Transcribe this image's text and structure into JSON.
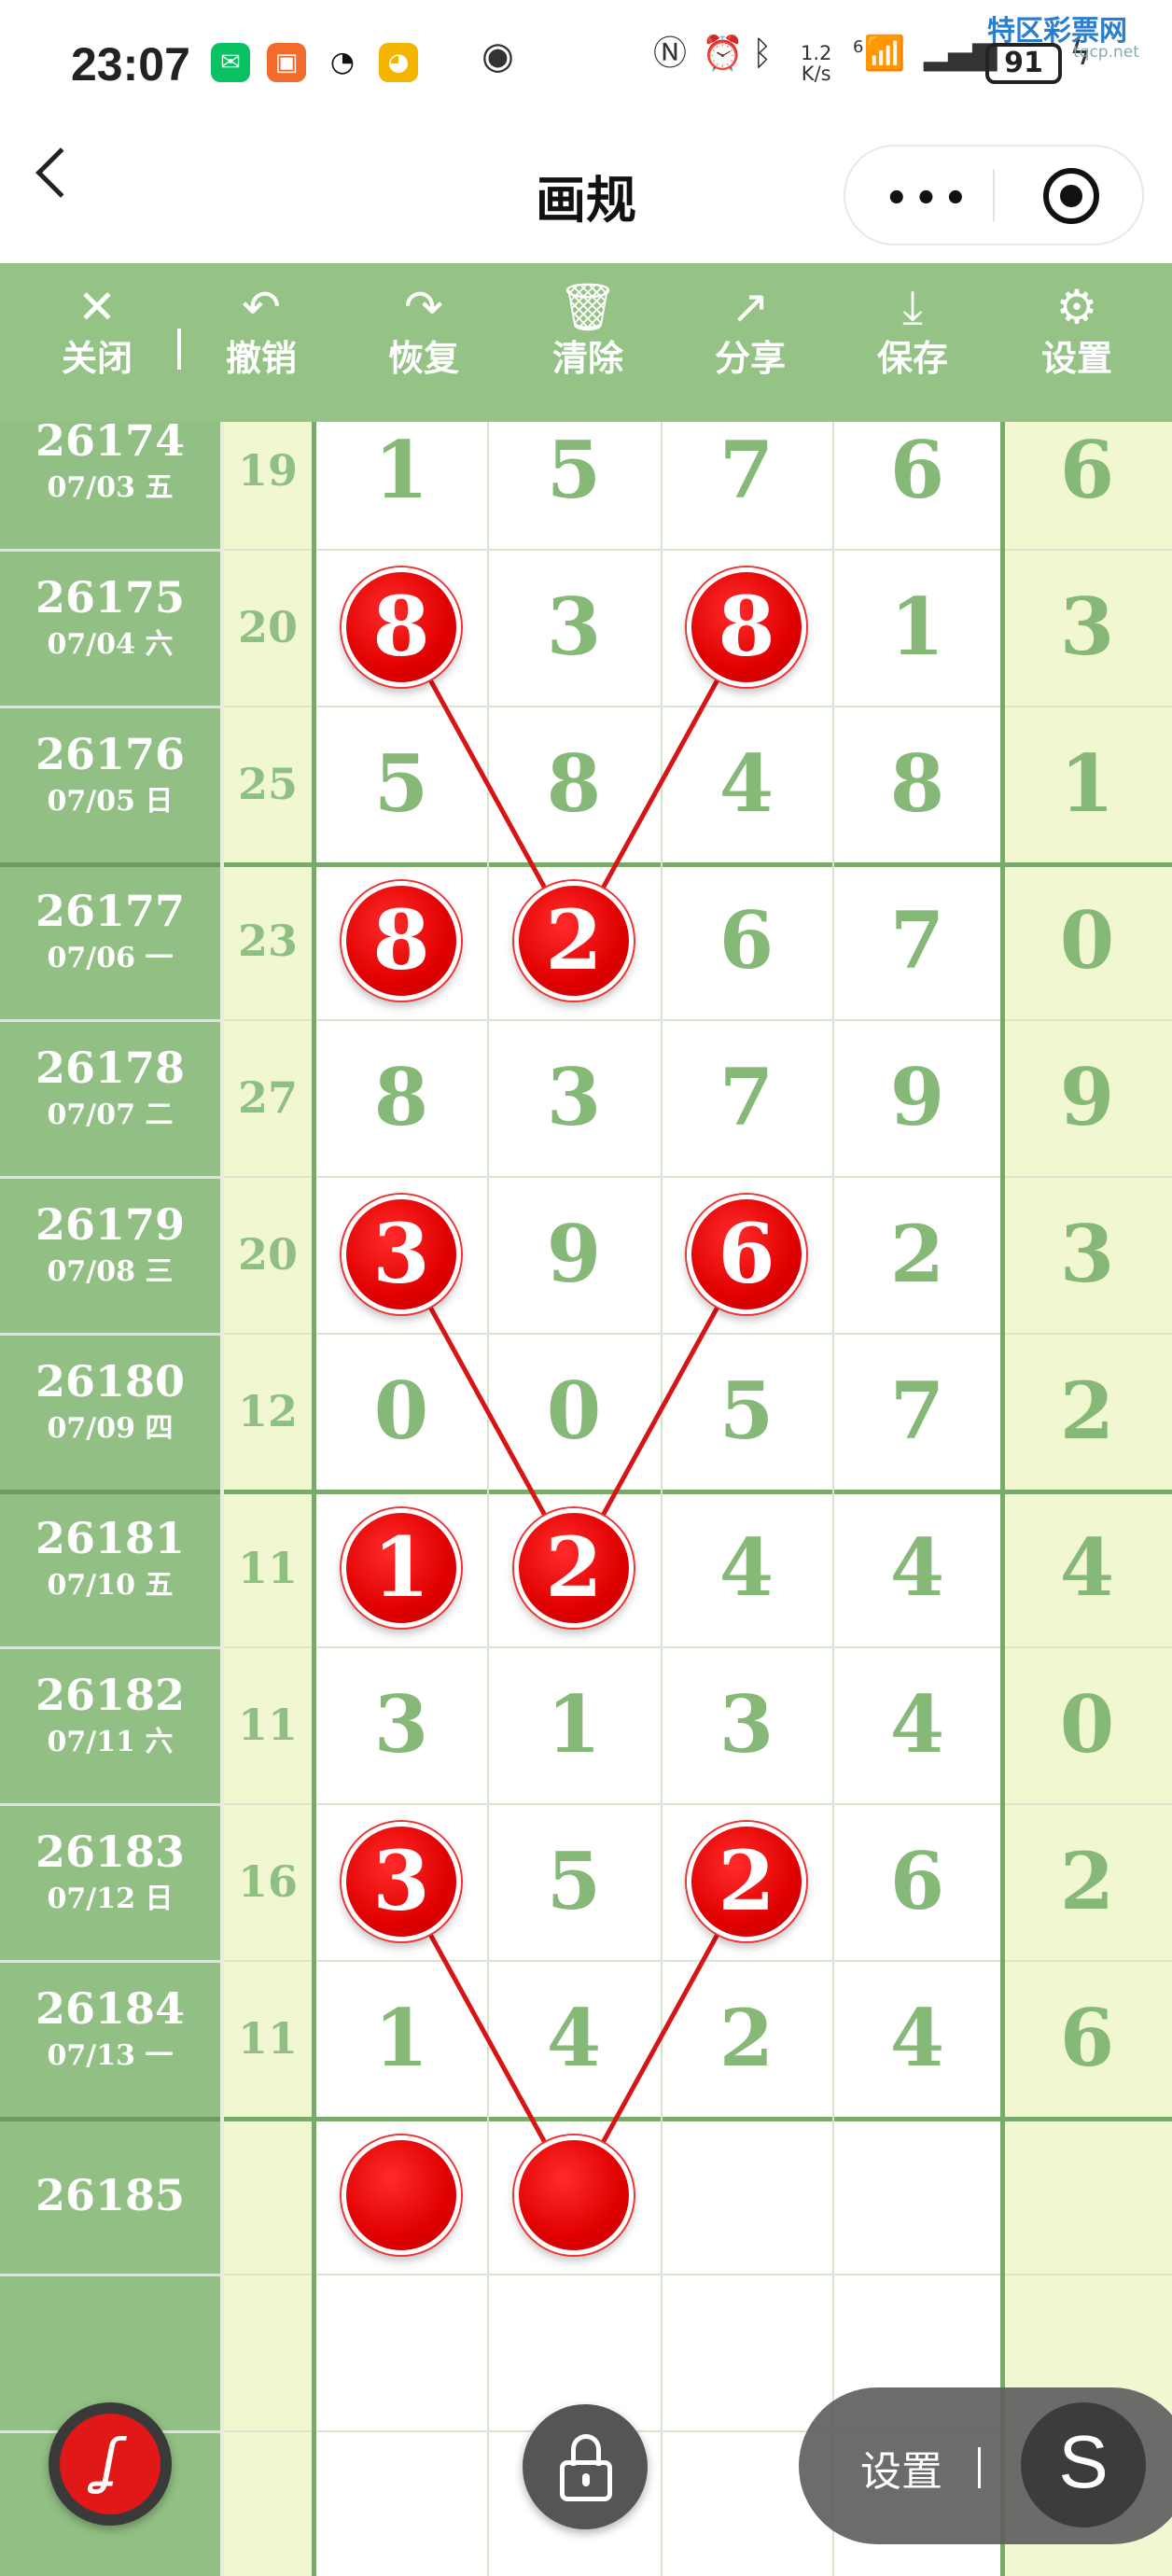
{
  "status_bar": {
    "time": "23:07",
    "apps": [
      {
        "icon": "wechat-icon",
        "glyph": "✉",
        "color": "#09c160"
      },
      {
        "icon": "app-orange-icon",
        "glyph": "▣",
        "color": "#f36b2a"
      },
      {
        "icon": "qq-icon",
        "glyph": "🐧",
        "color": "#ffffff"
      },
      {
        "icon": "weibo-icon",
        "glyph": "◕",
        "color": "#f5b400"
      }
    ],
    "eye_icon": "eye-icon",
    "net_speed_value": "1.2",
    "net_speed_unit": "K/s",
    "signal_label": "6",
    "battery": "91",
    "watermark_brand": "特区彩票网",
    "watermark_domain": "tqcp.net"
  },
  "nav": {
    "title": "画规"
  },
  "toolbar": {
    "buttons": [
      {
        "icon": "close-icon",
        "glyph": "✕",
        "label": "关闭"
      },
      {
        "icon": "undo-icon",
        "glyph": "↶",
        "label": "撤销"
      },
      {
        "icon": "redo-icon",
        "glyph": "↷",
        "label": "恢复"
      },
      {
        "icon": "trash-icon",
        "glyph": "🗑",
        "label": "清除"
      },
      {
        "icon": "share-icon",
        "glyph": "↗",
        "label": "分享"
      },
      {
        "icon": "download-icon",
        "glyph": "⤓",
        "label": "保存"
      },
      {
        "icon": "settings-icon",
        "glyph": "⚙",
        "label": "设置"
      }
    ]
  },
  "rows": [
    {
      "issue": "26174",
      "date": "07/03 五",
      "sum": "19",
      "digits": [
        "1",
        "5",
        "7",
        "6",
        "6"
      ]
    },
    {
      "issue": "26175",
      "date": "07/04 六",
      "sum": "20",
      "digits": [
        "8",
        "3",
        "8",
        "1",
        "3"
      ]
    },
    {
      "issue": "26176",
      "date": "07/05 日",
      "sum": "25",
      "digits": [
        "5",
        "8",
        "4",
        "8",
        "1"
      ]
    },
    {
      "issue": "26177",
      "date": "07/06 一",
      "sum": "23",
      "digits": [
        "8",
        "2",
        "6",
        "7",
        "0"
      ]
    },
    {
      "issue": "26178",
      "date": "07/07 二",
      "sum": "27",
      "digits": [
        "8",
        "3",
        "7",
        "9",
        "9"
      ]
    },
    {
      "issue": "26179",
      "date": "07/08 三",
      "sum": "20",
      "digits": [
        "3",
        "9",
        "6",
        "2",
        "3"
      ]
    },
    {
      "issue": "26180",
      "date": "07/09 四",
      "sum": "12",
      "digits": [
        "0",
        "0",
        "5",
        "7",
        "2"
      ]
    },
    {
      "issue": "26181",
      "date": "07/10 五",
      "sum": "11",
      "digits": [
        "1",
        "2",
        "4",
        "4",
        "4"
      ]
    },
    {
      "issue": "26182",
      "date": "07/11 六",
      "sum": "11",
      "digits": [
        "3",
        "1",
        "3",
        "4",
        "0"
      ]
    },
    {
      "issue": "26183",
      "date": "07/12 日",
      "sum": "16",
      "digits": [
        "3",
        "5",
        "2",
        "6",
        "2"
      ]
    },
    {
      "issue": "26184",
      "date": "07/13 一",
      "sum": "11",
      "digits": [
        "1",
        "4",
        "2",
        "4",
        "6"
      ]
    },
    {
      "issue": "26185",
      "date": "",
      "sum": "",
      "digits": [
        "",
        "",
        "",
        "",
        ""
      ]
    }
  ],
  "marked_balls": [
    {
      "row": 1,
      "col": 0,
      "label": "8"
    },
    {
      "row": 1,
      "col": 2,
      "label": "8"
    },
    {
      "row": 3,
      "col": 0,
      "label": "8"
    },
    {
      "row": 3,
      "col": 1,
      "label": "2"
    },
    {
      "row": 5,
      "col": 0,
      "label": "3"
    },
    {
      "row": 5,
      "col": 2,
      "label": "6"
    },
    {
      "row": 7,
      "col": 0,
      "label": "1"
    },
    {
      "row": 7,
      "col": 1,
      "label": "2"
    },
    {
      "row": 9,
      "col": 0,
      "label": "3"
    },
    {
      "row": 9,
      "col": 2,
      "label": "2"
    },
    {
      "row": 11,
      "col": 0,
      "label": ""
    },
    {
      "row": 11,
      "col": 1,
      "label": ""
    }
  ],
  "drawn_lines": [
    {
      "from": {
        "row": 1,
        "col": 0
      },
      "to": {
        "row": 3,
        "col": 1
      }
    },
    {
      "from": {
        "row": 1,
        "col": 2
      },
      "to": {
        "row": 3,
        "col": 1
      }
    },
    {
      "from": {
        "row": 5,
        "col": 0
      },
      "to": {
        "row": 7,
        "col": 1
      }
    },
    {
      "from": {
        "row": 5,
        "col": 2
      },
      "to": {
        "row": 7,
        "col": 1
      }
    },
    {
      "from": {
        "row": 9,
        "col": 0
      },
      "to": {
        "row": 11,
        "col": 1
      }
    },
    {
      "from": {
        "row": 9,
        "col": 2
      },
      "to": {
        "row": 11,
        "col": 1
      }
    }
  ],
  "bottom": {
    "settings_label": "设置",
    "switch_label": "S"
  },
  "colors": {
    "toolbar_green": "#95c386",
    "ball_red": "#e00000",
    "digit_green": "#86b878"
  }
}
